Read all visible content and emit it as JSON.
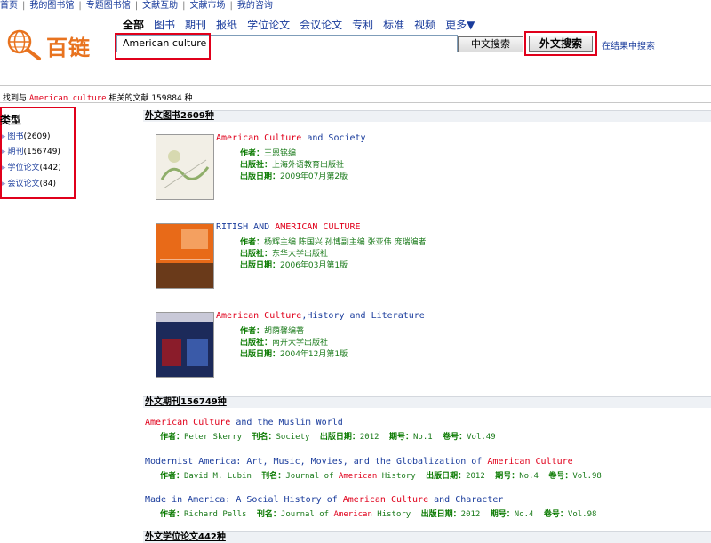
{
  "topnav": [
    "首页",
    "我的图书馆",
    "专题图书馆",
    "文献互助",
    "文献市场",
    "我的咨询"
  ],
  "logo": {
    "text": "百链"
  },
  "categories": [
    "全部",
    "图书",
    "期刊",
    "报纸",
    "学位论文",
    "会议论文",
    "专利",
    "标准",
    "视频",
    "更多▼"
  ],
  "search": {
    "value": "American culture",
    "btn_cn": "中文搜索",
    "btn_en": "外文搜索",
    "in_results": "在结果中搜索"
  },
  "found": {
    "prefix": "找到与",
    "keyword": "American culture",
    "suffix": "相关的文献 159884 种"
  },
  "sidebar": {
    "title": "类型",
    "items": [
      {
        "label": "图书",
        "count": "(2609)"
      },
      {
        "label": "期刊",
        "count": "(156749)"
      },
      {
        "label": "学位论文",
        "count": "(442)"
      },
      {
        "label": "会议论文",
        "count": "(84)"
      }
    ]
  },
  "sections": {
    "books": "外文图书2609种",
    "journals": "外文期刊156749种",
    "theses": "外文学位论文442种"
  },
  "labels": {
    "author": "作者：",
    "publisher": "出版社：",
    "pubdate": "出版日期：",
    "journal": "刊名：",
    "issue": "期号：",
    "volume": "卷号："
  },
  "books": [
    {
      "title_hl": "American Culture",
      "title_rest": " and Society",
      "author": "王恩铭编",
      "publisher": "上海外语教育出版社",
      "date": "2009年07月第2版"
    },
    {
      "title_pre": "RITISH AND ",
      "title_hl": "AMERICAN CULTURE",
      "author": "杨辉主编 陈国兴 孙博副主编 张亚伟 庞瑞编者",
      "publisher": "东华大学出版社",
      "date": "2006年03月第1版"
    },
    {
      "title_hl": "American Culture",
      "title_rest": ",History and Literature",
      "author": "胡荫馨编著",
      "publisher": "南开大学出版社",
      "date": "2004年12月第1版"
    }
  ],
  "articles": [
    {
      "t1": "",
      "hl": "American Culture",
      "t2": " and the Muslim World",
      "author": "Peter Skerry",
      "journal_pre": "Society",
      "journal_hl": "",
      "journal_post": "",
      "date": "2012",
      "issue": "No.1",
      "volume": "Vol.49"
    },
    {
      "t1": "Modernist America: Art, Music, Movies, and the Globalization of ",
      "hl": "American Culture",
      "t2": "",
      "author": "David M. Lubin",
      "journal_pre": "Journal of ",
      "journal_hl": "American",
      "journal_post": " History",
      "date": "2012",
      "issue": "No.4",
      "volume": "Vol.98"
    },
    {
      "t1": "Made in America: A Social History of ",
      "hl": "American Culture",
      "t2": " and Character",
      "author": "Richard Pells",
      "journal_pre": "Journal of ",
      "journal_hl": "American",
      "journal_post": " History",
      "date": "2012",
      "issue": "No.4",
      "volume": "Vol.98"
    }
  ],
  "colors": {
    "link": "#1a3c9c",
    "highlight": "#e0001b",
    "label_green": "#0a7a00",
    "brand_orange": "#e8731f"
  }
}
